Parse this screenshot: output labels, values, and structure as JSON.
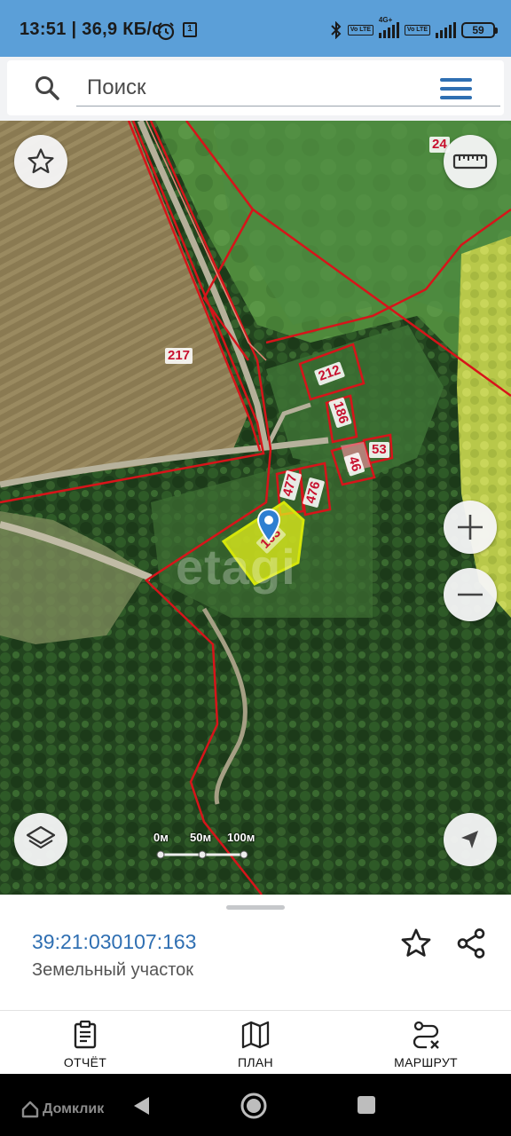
{
  "status_bar": {
    "time": "13:51",
    "speed": "36,9 КБ/с",
    "calendar_badge": "1",
    "volte_1": "Vo LTE",
    "volte_2": "Vo LTE",
    "net_1": "4G+",
    "battery": "59",
    "icons": [
      "alarm-icon",
      "calendar-icon",
      "bluetooth-icon",
      "signal-icon",
      "battery-icon"
    ]
  },
  "search": {
    "placeholder": "Поиск",
    "icon": "search-icon",
    "menu_icon": "hamburger-menu-icon"
  },
  "map": {
    "parcel_labels": [
      {
        "id": "217",
        "text": "217"
      },
      {
        "id": "212",
        "text": "212"
      },
      {
        "id": "186",
        "text": "186"
      },
      {
        "id": "53",
        "text": "53"
      },
      {
        "id": "46",
        "text": "46"
      },
      {
        "id": "477",
        "text": "477"
      },
      {
        "id": "476",
        "text": "476"
      },
      {
        "id": "163",
        "text": "163"
      },
      {
        "id": "24",
        "text": "24"
      }
    ],
    "watermark": "etagi",
    "scale": {
      "labels": [
        "0м",
        "50м",
        "100м"
      ]
    },
    "buttons": {
      "favorite": "star-icon",
      "ruler": "ruler-icon",
      "zoom_in": "plus-icon",
      "zoom_out": "minus-icon",
      "layers": "layers-icon",
      "locate": "navigation-arrow-icon"
    },
    "colors": {
      "boundary": "#d7141a",
      "selected_fill": "#e6f21b",
      "marker": "#2f7fd1"
    }
  },
  "sheet": {
    "cadastral_number": "39:21:030107:163",
    "object_type": "Земельный участок",
    "icons": [
      "star-outline-icon",
      "share-icon"
    ]
  },
  "tabs": [
    {
      "label": "ОТЧЁТ",
      "icon": "clipboard-icon"
    },
    {
      "label": "ПЛАН",
      "icon": "map-icon"
    },
    {
      "label": "МАРШРУТ",
      "icon": "route-icon"
    }
  ],
  "system_nav": {
    "brand": "Домклик",
    "icons": [
      "back-icon",
      "home-icon",
      "recents-icon"
    ]
  }
}
